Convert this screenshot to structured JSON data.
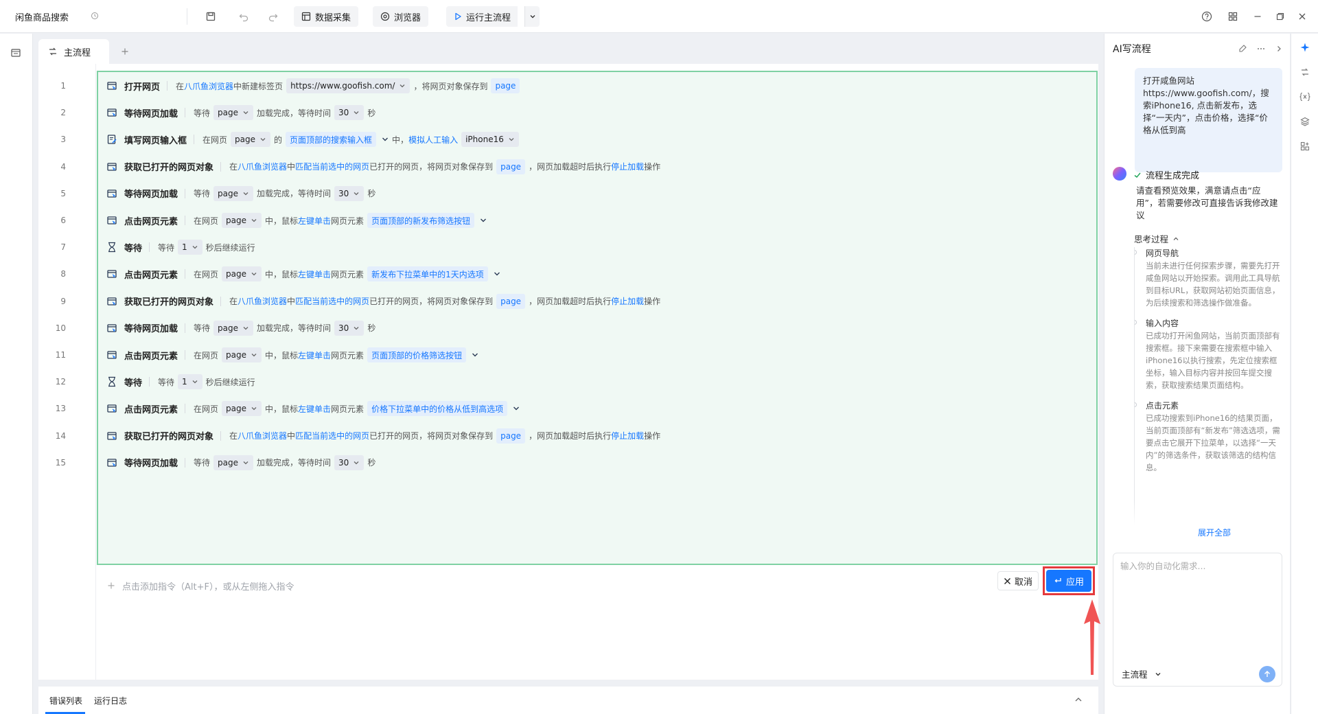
{
  "app": {
    "title": "闲鱼商品搜索"
  },
  "toolbar": {
    "data_collect": "数据采集",
    "browser": "浏览器",
    "run_main": "运行主流程"
  },
  "tabs": {
    "main": "主流程"
  },
  "rows": [
    {
      "num": "1",
      "title": "打开网页",
      "parts": [
        [
          "t",
          "在"
        ],
        [
          "lnk",
          "八爪鱼浏览器"
        ],
        [
          "t",
          "中新建标签页"
        ],
        [
          "tag",
          "https://www.goofish.com/"
        ],
        [
          "t",
          "，将网页对象保存到"
        ],
        [
          "tagb",
          "page"
        ]
      ]
    },
    {
      "num": "2",
      "title": "等待网页加载",
      "parts": [
        [
          "t",
          "等待"
        ],
        [
          "tag",
          "page"
        ],
        [
          "t",
          "加载完成，等待时间"
        ],
        [
          "tag",
          "30"
        ],
        [
          "t",
          "秒"
        ]
      ]
    },
    {
      "num": "3",
      "title": "填写网页输入框",
      "parts": [
        [
          "t",
          "在网页"
        ],
        [
          "tag",
          "page"
        ],
        [
          "t",
          "的"
        ],
        [
          "tagb",
          "页面顶部的搜索输入框"
        ],
        [
          "drop",
          ""
        ],
        [
          "t",
          "中，"
        ],
        [
          "lnk",
          "模拟人工输入"
        ],
        [
          "tag",
          "iPhone16"
        ]
      ]
    },
    {
      "num": "4",
      "title": "获取已打开的网页对象",
      "parts": [
        [
          "t",
          "在"
        ],
        [
          "lnk",
          "八爪鱼浏览器"
        ],
        [
          "t",
          "中"
        ],
        [
          "lnk",
          "匹配当前选中的网页"
        ],
        [
          "t",
          "已打开的网页，将网页对象保存到"
        ],
        [
          "tagb",
          "page"
        ],
        [
          "t",
          "，网页加载超时后执行"
        ],
        [
          "lnk",
          "停止加载"
        ],
        [
          "t",
          "操作"
        ]
      ]
    },
    {
      "num": "5",
      "title": "等待网页加载",
      "parts": [
        [
          "t",
          "等待"
        ],
        [
          "tag",
          "page"
        ],
        [
          "t",
          "加载完成，等待时间"
        ],
        [
          "tag",
          "30"
        ],
        [
          "t",
          "秒"
        ]
      ]
    },
    {
      "num": "6",
      "title": "点击网页元素",
      "parts": [
        [
          "t",
          "在网页"
        ],
        [
          "tag",
          "page"
        ],
        [
          "t",
          "中，鼠标"
        ],
        [
          "lnk",
          "左键单击"
        ],
        [
          "t",
          "网页元素"
        ],
        [
          "tagb",
          "页面顶部的新发布筛选按钮"
        ],
        [
          "drop",
          ""
        ]
      ]
    },
    {
      "num": "7",
      "title": "等待",
      "parts": [
        [
          "t",
          "等待"
        ],
        [
          "tag",
          "1"
        ],
        [
          "t",
          "秒后继续运行"
        ]
      ]
    },
    {
      "num": "8",
      "title": "点击网页元素",
      "parts": [
        [
          "t",
          "在网页"
        ],
        [
          "tag",
          "page"
        ],
        [
          "t",
          "中，鼠标"
        ],
        [
          "lnk",
          "左键单击"
        ],
        [
          "t",
          "网页元素"
        ],
        [
          "tagb",
          "新发布下拉菜单中的1天内选项"
        ],
        [
          "drop",
          ""
        ]
      ]
    },
    {
      "num": "9",
      "title": "获取已打开的网页对象",
      "parts": [
        [
          "t",
          "在"
        ],
        [
          "lnk",
          "八爪鱼浏览器"
        ],
        [
          "t",
          "中"
        ],
        [
          "lnk",
          "匹配当前选中的网页"
        ],
        [
          "t",
          "已打开的网页，将网页对象保存到"
        ],
        [
          "tagb",
          "page"
        ],
        [
          "t",
          "，网页加载超时后执行"
        ],
        [
          "lnk",
          "停止加载"
        ],
        [
          "t",
          "操作"
        ]
      ]
    },
    {
      "num": "10",
      "title": "等待网页加载",
      "parts": [
        [
          "t",
          "等待"
        ],
        [
          "tag",
          "page"
        ],
        [
          "t",
          "加载完成，等待时间"
        ],
        [
          "tag",
          "30"
        ],
        [
          "t",
          "秒"
        ]
      ]
    },
    {
      "num": "11",
      "title": "点击网页元素",
      "parts": [
        [
          "t",
          "在网页"
        ],
        [
          "tag",
          "page"
        ],
        [
          "t",
          "中，鼠标"
        ],
        [
          "lnk",
          "左键单击"
        ],
        [
          "t",
          "网页元素"
        ],
        [
          "tagb",
          "页面顶部的价格筛选按钮"
        ],
        [
          "drop",
          ""
        ]
      ]
    },
    {
      "num": "12",
      "title": "等待",
      "parts": [
        [
          "t",
          "等待"
        ],
        [
          "tag",
          "1"
        ],
        [
          "t",
          "秒后继续运行"
        ]
      ]
    },
    {
      "num": "13",
      "title": "点击网页元素",
      "parts": [
        [
          "t",
          "在网页"
        ],
        [
          "tag",
          "page"
        ],
        [
          "t",
          "中，鼠标"
        ],
        [
          "lnk",
          "左键单击"
        ],
        [
          "t",
          "网页元素"
        ],
        [
          "tagb",
          "价格下拉菜单中的价格从低到高选项"
        ],
        [
          "drop",
          ""
        ]
      ]
    },
    {
      "num": "14",
      "title": "获取已打开的网页对象",
      "parts": [
        [
          "t",
          "在"
        ],
        [
          "lnk",
          "八爪鱼浏览器"
        ],
        [
          "t",
          "中"
        ],
        [
          "lnk",
          "匹配当前选中的网页"
        ],
        [
          "t",
          "已打开的网页，将网页对象保存到"
        ],
        [
          "tagb",
          "page"
        ],
        [
          "t",
          "，网页加载超时后执行"
        ],
        [
          "lnk",
          "停止加载"
        ],
        [
          "t",
          "操作"
        ]
      ]
    },
    {
      "num": "15",
      "title": "等待网页加载",
      "parts": [
        [
          "t",
          "等待"
        ],
        [
          "tag",
          "page"
        ],
        [
          "t",
          "加载完成，等待时间"
        ],
        [
          "tag",
          "30"
        ],
        [
          "t",
          "秒"
        ]
      ]
    }
  ],
  "row_icons": [
    "web-icon",
    "web-icon",
    "input-icon",
    "web-icon",
    "web-icon",
    "web-icon",
    "hourglass-icon",
    "web-icon",
    "web-icon",
    "web-icon",
    "web-icon",
    "hourglass-icon",
    "web-icon",
    "web-icon",
    "web-icon"
  ],
  "editor": {
    "add_command_hint": "点击添加指令（Alt+F），或从左侧拖入指令",
    "cancel_label": "取消",
    "apply_label": "应用"
  },
  "bottom": {
    "error_list": "错误列表",
    "run_log": "运行日志"
  },
  "ai_panel": {
    "title": "AI写流程",
    "user_message": "打开咸鱼网站https://www.goofish.com/，搜索iPhone16, 点击新发布，选择“一天内”，点击价格，选择“价格从低到高",
    "status": "流程生成完成",
    "reply": "请查看预览效果，满意请点击“应用”，若需要修改可直接告诉我修改建议",
    "thinking_label": "思考过程",
    "thinking_steps": [
      {
        "title": "网页导航",
        "desc": "当前未进行任何探索步骤，需要先打开咸鱼网站以开始探索。调用此工具导航到目标URL，获取网站初始页面信息，为后续搜索和筛选操作做准备。"
      },
      {
        "title": "输入内容",
        "desc": "已成功打开闲鱼网站，当前页面顶部有搜索框。接下来需要在搜索框中输入iPhone16以执行搜索，先定位搜索框坐标，输入目标内容并按回车提交搜索，获取搜索结果页面结构。"
      },
      {
        "title": "点击元素",
        "desc": "已成功搜索到iPhone16的结果页面，当前页面顶部有“新发布”筛选选项，需要点击它展开下拉菜单，以选择“一天内”的筛选条件，获取该筛选的结构信息。"
      }
    ],
    "expand_all": "展开全部",
    "input_placeholder": "输入你的自动化需求...",
    "flow_select": "主流程"
  }
}
